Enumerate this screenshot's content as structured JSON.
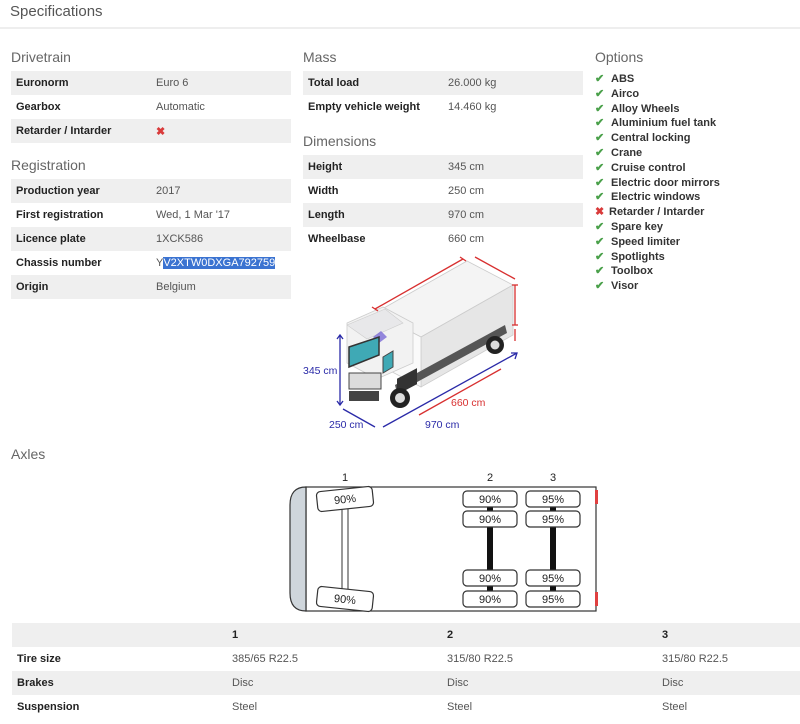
{
  "header": {
    "title": "Specifications"
  },
  "drivetrain": {
    "title": "Drivetrain",
    "rows": [
      {
        "label": "Euronorm",
        "value": "Euro 6"
      },
      {
        "label": "Gearbox",
        "value": "Automatic"
      },
      {
        "label": "Retarder / Intarder",
        "value": "✖",
        "status": "no"
      }
    ]
  },
  "registration": {
    "title": "Registration",
    "rows": [
      {
        "label": "Production year",
        "value": "2017"
      },
      {
        "label": "First registration",
        "value": "Wed, 1 Mar '17"
      },
      {
        "label": "Licence plate",
        "value": "1XCK586"
      },
      {
        "label": "Chassis number",
        "value_prefix": "Y",
        "value_selected": "V2XTW0DXGA792759"
      },
      {
        "label": "Origin",
        "value": "Belgium"
      }
    ]
  },
  "mass": {
    "title": "Mass",
    "rows": [
      {
        "label": "Total load",
        "value": "26.000 kg"
      },
      {
        "label": "Empty vehicle weight",
        "value": "14.460 kg"
      }
    ]
  },
  "dimensions": {
    "title": "Dimensions",
    "rows": [
      {
        "label": "Height",
        "value": "345 cm"
      },
      {
        "label": "Width",
        "value": "250 cm"
      },
      {
        "label": "Length",
        "value": "970 cm"
      },
      {
        "label": "Wheelbase",
        "value": "660 cm"
      }
    ],
    "diagram": {
      "height_label": "345 cm",
      "width_label": "250 cm",
      "length_label": "970 cm",
      "wheelbase_label": "660 cm"
    }
  },
  "options": {
    "title": "Options",
    "items": [
      {
        "label": "ABS",
        "available": true,
        "icon": "✔"
      },
      {
        "label": "Airco",
        "available": true,
        "icon": "✔"
      },
      {
        "label": "Alloy Wheels",
        "available": true,
        "icon": "✔"
      },
      {
        "label": "Aluminium fuel tank",
        "available": true,
        "icon": "✔"
      },
      {
        "label": "Central locking",
        "available": true,
        "icon": "✔"
      },
      {
        "label": "Crane",
        "available": true,
        "icon": "✔"
      },
      {
        "label": "Cruise control",
        "available": true,
        "icon": "✔"
      },
      {
        "label": "Electric door mirrors",
        "available": true,
        "icon": "✔"
      },
      {
        "label": "Electric windows",
        "available": true,
        "icon": "✔"
      },
      {
        "label": "Retarder / Intarder",
        "available": false,
        "icon": "✖"
      },
      {
        "label": "Spare key",
        "available": true,
        "icon": "✔"
      },
      {
        "label": "Speed limiter",
        "available": true,
        "icon": "✔"
      },
      {
        "label": "Spotlights",
        "available": true,
        "icon": "✔"
      },
      {
        "label": "Toolbox",
        "available": true,
        "icon": "✔"
      },
      {
        "label": "Visor",
        "available": true,
        "icon": "✔"
      }
    ]
  },
  "axles": {
    "title": "Axles",
    "diagram": {
      "axle_numbers": [
        "1",
        "2",
        "3"
      ],
      "axle1": {
        "top": "90%",
        "bottom": "90%"
      },
      "axle2": {
        "outer_top": "90%",
        "inner_top": "90%",
        "inner_bottom": "90%",
        "outer_bottom": "90%"
      },
      "axle3": {
        "outer_top": "95%",
        "inner_top": "95%",
        "inner_bottom": "95%",
        "outer_bottom": "95%"
      }
    },
    "table": {
      "headers": [
        "",
        "1",
        "2",
        "3"
      ],
      "rows": [
        {
          "label": "Tire size",
          "values": [
            "385/65 R22.5",
            "315/80 R22.5",
            "315/80 R22.5"
          ]
        },
        {
          "label": "Brakes",
          "values": [
            "Disc",
            "Disc",
            "Disc"
          ]
        },
        {
          "label": "Suspension",
          "values": [
            "Steel",
            "Steel",
            "Steel"
          ]
        }
      ]
    }
  },
  "colors": {
    "accent_blue": "#2a2aa8",
    "accent_red": "#d83030",
    "check_green": "#4aa04a",
    "selection": "#3b73d1"
  }
}
